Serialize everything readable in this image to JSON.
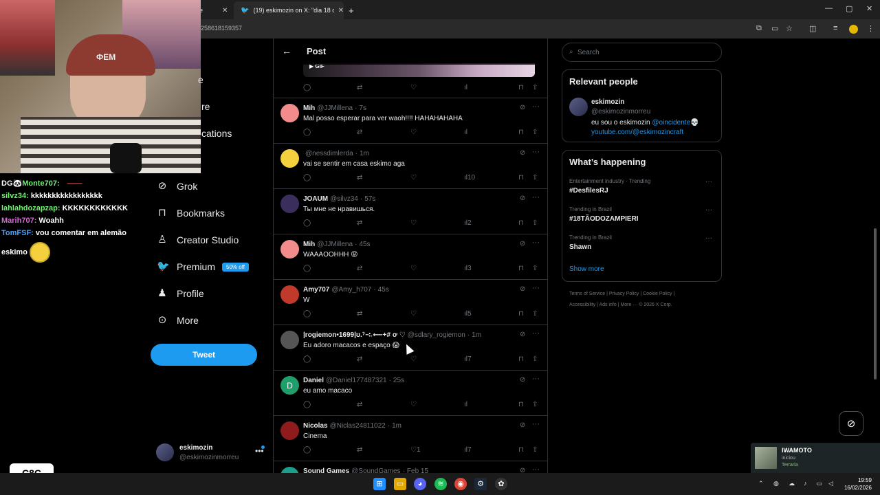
{
  "browser": {
    "tabs": [
      {
        "title": "e"
      },
      {
        "title": "(19) eskimozin on X: \"dia 18 de"
      }
    ],
    "new_tab": "+",
    "url": "258618159357",
    "window_controls": [
      "—",
      "▢",
      "✕"
    ]
  },
  "overlay": {
    "hat_text": "ФЕМ",
    "chat": [
      {
        "user": "Monte707:",
        "user_color": "#6ef26e",
        "text": "——",
        "prefix": "DG🐼"
      },
      {
        "user": "silvz34:",
        "user_color": "#6ef26e",
        "text": "kkkkkkkkkkkkkkkkk"
      },
      {
        "user": "lahlahdozapzap:",
        "user_color": "#6ef26e",
        "text": "KKKKKKKKKKKK"
      },
      {
        "user": "Marih707:",
        "user_color": "#d36ad6",
        "text": "Woahh"
      },
      {
        "user": "TomFSF:",
        "user_color": "#4aa3ff",
        "text": "vou comentar em alemão"
      },
      {
        "user": "",
        "user_color": "#ffffff",
        "text": "eskimo"
      }
    ],
    "bottom_logo": "C8C"
  },
  "nav": {
    "cut_items": [
      "e",
      "re",
      "cations"
    ],
    "items": [
      {
        "label": "Grok",
        "icon": "grok-icon"
      },
      {
        "label": "Bookmarks",
        "icon": "bookmark-icon"
      },
      {
        "label": "Creator Studio",
        "icon": "creator-studio-icon"
      },
      {
        "label": "Premium",
        "icon": "premium-bird-icon",
        "badge": "50% off"
      },
      {
        "label": "Profile",
        "icon": "profile-icon"
      },
      {
        "label": "More",
        "icon": "more-circle-icon"
      }
    ],
    "tweet_button": "Tweet",
    "account": {
      "name": "eskimozin",
      "handle": "@eskimozinmorreu",
      "more": "•••"
    }
  },
  "post": {
    "title": "Post",
    "gif_badge": "▶  GIF",
    "top_actions": {
      "reply": "",
      "retweet": "",
      "like": "",
      "views": ""
    },
    "replies": [
      {
        "name": "Mih",
        "handle": "@JJMillena",
        "time": "7s",
        "text": "Mal posso esperar para ver waoh!!!! HAHAHAHAHA",
        "views": "",
        "likes": "",
        "avatar_color": "#f28b8b"
      },
      {
        "name": "",
        "handle": "@nessdimlerda",
        "time": "1m",
        "text": "vai se sentir em casa eskimo aga",
        "views": "10",
        "likes": "",
        "avatar_color": "#f4d03f"
      },
      {
        "name": "JOAUM",
        "handle": "@silvz34",
        "time": "57s",
        "text": "Ты мне не нравишься.",
        "views": "2",
        "likes": "",
        "avatar_color": "#3a2f5c"
      },
      {
        "name": "Mih",
        "handle": "@JJMillena",
        "time": "45s",
        "text": "WAAAOOHHH 😝",
        "views": "3",
        "likes": "",
        "avatar_color": "#f28b8b"
      },
      {
        "name": "Amy707",
        "handle": "@Amy_h707",
        "time": "45s",
        "text": "W",
        "views": "5",
        "likes": "",
        "avatar_color": "#c0392b"
      },
      {
        "name": "|rogiemon•1699|ʊ.ˀ∹˒⟵+# ơ ♡",
        "handle": "@sdlary_rogiemon",
        "time": "1m",
        "text": "Eu adoro macacos e espaço 😱",
        "views": "7",
        "likes": "",
        "avatar_color": "#555555"
      },
      {
        "name": "Daniel",
        "handle": "@Daniel177487321",
        "time": "25s",
        "text": "eu amo macaco",
        "views": "",
        "likes": "",
        "avatar_color": "#1e9e6a",
        "initial": "D"
      },
      {
        "name": "Nicolas",
        "handle": "@Niclas24811022",
        "time": "1m",
        "text": "Cinema",
        "views": "7",
        "likes": "1",
        "avatar_color": "#8e1c1c"
      },
      {
        "name": "Sound Games",
        "handle": "@SoundGames",
        "time": "Feb 15",
        "text": "",
        "views": "",
        "likes": "",
        "avatar_color": "#1b9e8a"
      }
    ]
  },
  "right": {
    "search_placeholder": "Search",
    "relevant_people": {
      "title": "Relevant people",
      "name": "eskimozin",
      "handle": "@eskimozinmorreu",
      "bio": "eu sou o eskimozin",
      "bio_mention": "@oincidente",
      "bio_emoji": "💀",
      "link": "youtube.com/@eskimozincraft"
    },
    "happening": {
      "title": "What’s happening",
      "trends": [
        {
          "category": "Entertainment industry · Trending",
          "name": "#DesfilesRJ"
        },
        {
          "category": "Trending in Brazil",
          "name": "#18TÃODOZAMPIERI"
        },
        {
          "category": "Trending in Brazil",
          "name": "Shawn"
        }
      ],
      "show_more": "Show more"
    },
    "footer_line1": "Terms of Service  |  Privacy Policy  |  Cookie Policy  |",
    "footer_line2": "Accessibility  |  Ads info  |  More ···  © 2026 X Corp."
  },
  "notification": {
    "title": "IWAMOTO",
    "line1": "iniciou",
    "line2": "Terraria"
  },
  "taskbar": {
    "time": "19:59",
    "date": "16/02/2026"
  }
}
